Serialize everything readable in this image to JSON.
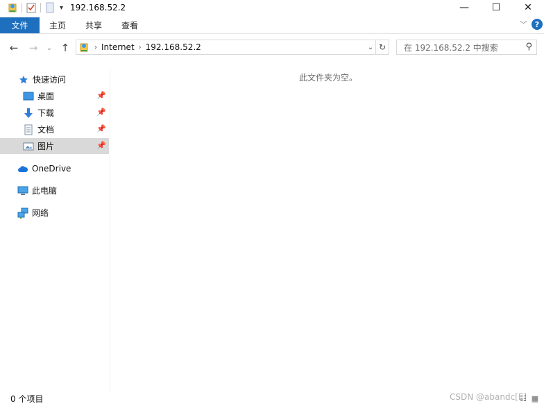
{
  "window": {
    "title": "192.168.52.2",
    "controls": {
      "minimize": "—",
      "maximize": "☐",
      "close": "✕"
    }
  },
  "ribbon": {
    "tabs": [
      "文件",
      "主页",
      "共享",
      "查看"
    ],
    "help": "?"
  },
  "address": {
    "crumbs": [
      "Internet",
      "192.168.52.2"
    ],
    "search_placeholder": "在 192.168.52.2 中搜索"
  },
  "navigation": {
    "quick_access": "快速访问",
    "pinned": [
      "桌面",
      "下载",
      "文档",
      "图片"
    ],
    "onedrive": "OneDrive",
    "this_pc": "此电脑",
    "network": "网络"
  },
  "main": {
    "empty_message": "此文件夹为空。"
  },
  "status": {
    "item_count": "0 个项目",
    "watermark": "CSDN @abandc[E]"
  },
  "colors": {
    "accent": "#1f6fbf",
    "selected_bg": "#d9d9d9",
    "folder_yellow": "#f4c84c"
  }
}
